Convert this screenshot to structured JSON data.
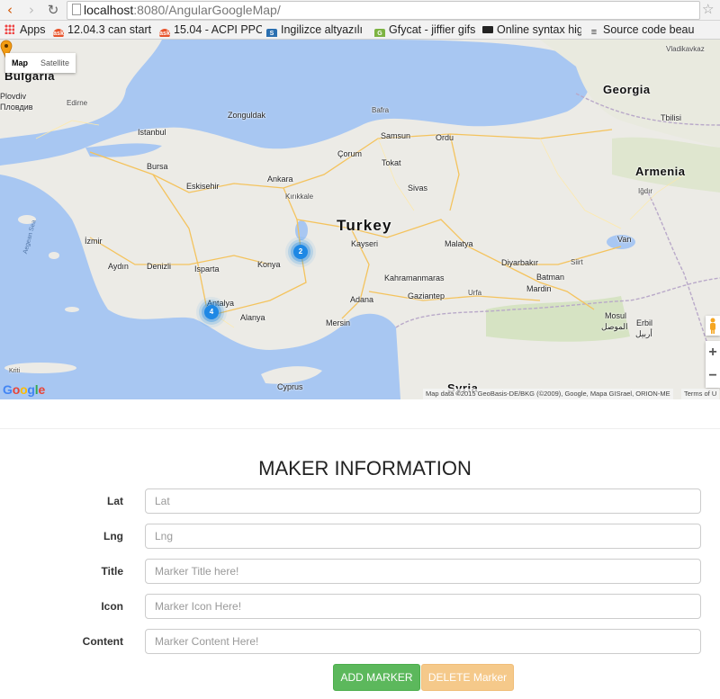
{
  "browser": {
    "url_host": "localhost",
    "url_rest": ":8080/AngularGoogleMap/",
    "bookmarks": [
      {
        "label": "Apps",
        "icon": "apps-icon"
      },
      {
        "label": "12.04.3 can start",
        "icon": "askubuntu-icon"
      },
      {
        "label": "15.04 - ACPI PPC P",
        "icon": "askubuntu-icon"
      },
      {
        "label": "Ingilizce altyazılı",
        "icon": "site-icon"
      },
      {
        "label": "Gfycat - jiffier gifs",
        "icon": "gfycat-icon"
      },
      {
        "label": "Online syntax hig",
        "icon": "terminal-icon"
      },
      {
        "label": "Source code beau",
        "icon": "list-icon"
      }
    ]
  },
  "map": {
    "type_buttons": [
      "Map",
      "Satellite"
    ],
    "clusters": [
      "2",
      "4"
    ],
    "attribution": "Map data ©2015 GeoBasis-DE/BKG (©2009), Google, Mapa GISrael, ORION-ME",
    "terms": "Terms of U",
    "zoom_in": "+",
    "zoom_out": "−",
    "google_logo": "Google",
    "labels": {
      "bulgaria": "Bulgaria",
      "plovdiv": "Plovdiv",
      "plovdiv_bg": "Пловдив",
      "edirne": "Edirne",
      "istanbul": "Istanbul",
      "bursa": "Bursa",
      "eskisehir": "Eskisehir",
      "izmir": "İzmir",
      "aydin": "Aydın",
      "denizli": "Denizli",
      "isparta": "Isparta",
      "antalya": "Antalya",
      "alanya": "Alanya",
      "konya": "Konya",
      "ankara": "Ankara",
      "kirikkale": "Kırıkkale",
      "zonguldak": "Zonguldak",
      "bafra": "Bafra",
      "samsun": "Samsun",
      "corum": "Çorum",
      "tokat": "Tokat",
      "ordu": "Ordu",
      "sivas": "Sivas",
      "turkey": "Turkey",
      "kayseri": "Kayseri",
      "malatya": "Malatya",
      "kahramanmaras": "Kahramanmaras",
      "gaziantep": "Gaziantep",
      "adana": "Adana",
      "mersin": "Mersin",
      "urfa": "Urfa",
      "diyarbakir": "Diyarbakır",
      "batman": "Batman",
      "mardin": "Mardin",
      "siirt": "Siirt",
      "van": "Van",
      "mosul": "Mosul",
      "mosul_ar": "الموصل",
      "erbil": "Erbil",
      "erbil_ar": "أربيل",
      "georgia": "Georgia",
      "tbilisi": "Tbilisi",
      "armenia": "Armenia",
      "vladikavkaz": "Vladikavkaz",
      "igdir": "Iğdır",
      "cyprus": "Cyprus",
      "syria": "Syria",
      "aegean_sea": "Aegean Sea",
      "kriti": "Kriti"
    }
  },
  "form": {
    "title": "MAKER INFORMATION",
    "fields": [
      {
        "label": "Lat",
        "placeholder": "Lat"
      },
      {
        "label": "Lng",
        "placeholder": "Lng"
      },
      {
        "label": "Title",
        "placeholder": "Marker Title here!"
      },
      {
        "label": "Icon",
        "placeholder": "Marker Icon Here!"
      },
      {
        "label": "Content",
        "placeholder": "Marker Content Here!"
      }
    ],
    "add_button": "ADD MARKER",
    "delete_button": "DELETE Marker"
  },
  "colors": {
    "water": "#a8c7f2",
    "land": "#ecebe6",
    "add_button": "#5cb85c",
    "delete_button": "#f5c98a",
    "cluster": "#1e88e5",
    "pin": "#f39c12"
  }
}
